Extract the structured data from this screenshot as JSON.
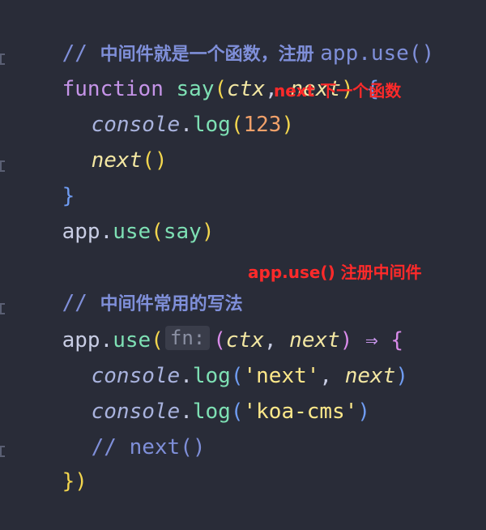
{
  "code": {
    "line1": {
      "comment_prefix": "// ",
      "comment_cjk": "中间件就是一个函数，注册 ",
      "comment_tail": "app.use()"
    },
    "line2": {
      "kw": "function",
      "name": "say",
      "lp": "(",
      "p1": "ctx",
      "comma": ", ",
      "p2": "next",
      "rp": ")",
      "brace": "{"
    },
    "line3": {
      "obj": "console",
      "dot": ".",
      "method": "log",
      "lp": "(",
      "num": "123",
      "rp": ")"
    },
    "line4": {
      "call": "next",
      "parens": "()"
    },
    "line5": {
      "brace": "}"
    },
    "line6": {
      "obj": "app",
      "dot": ".",
      "method": "use",
      "lp": "(",
      "arg": "say",
      "rp": ")"
    },
    "line8": {
      "comment_prefix": "// ",
      "comment_cjk": "中间件常用的写法"
    },
    "line9": {
      "obj": "app",
      "dot": ".",
      "method": "use",
      "lp": "(",
      "hint": "fn:",
      "lp2": "(",
      "p1": "ctx",
      "comma": ", ",
      "p2": "next",
      "rp2": ")",
      "arrow": "⇒",
      "brace": "{"
    },
    "line10": {
      "obj": "console",
      "dot": ".",
      "method": "log",
      "lp": "(",
      "str": "'next'",
      "comma": ", ",
      "arg": "next",
      "rp": ")"
    },
    "line11": {
      "obj": "console",
      "dot": ".",
      "method": "log",
      "lp": "(",
      "str": "'koa-cms'",
      "rp": ")"
    },
    "line12": {
      "comment": "// next()"
    },
    "line13": {
      "close": "})"
    }
  },
  "annotations": {
    "next_note": "next 下一个函数",
    "use_note": "app.use() 注册中间件"
  },
  "colors": {
    "background": "#292c38",
    "annotation": "#ff2a2a"
  }
}
